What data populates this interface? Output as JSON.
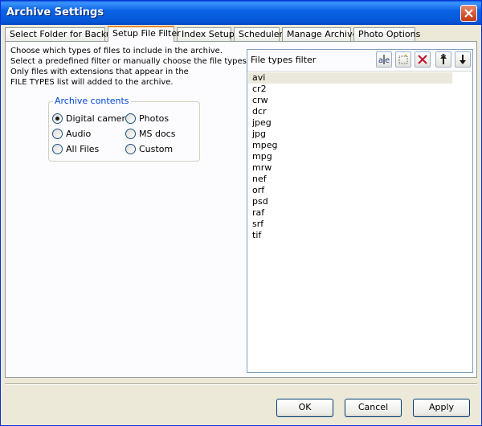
{
  "window": {
    "title": "Archive Settings"
  },
  "tabs": [
    {
      "label": "Select Folder for Backup"
    },
    {
      "label": "Setup File Filter"
    },
    {
      "label": "Index Setup"
    },
    {
      "label": "Scheduler"
    },
    {
      "label": "Manage Archive"
    },
    {
      "label": "Photo Options"
    }
  ],
  "active_tab": "Setup File Filter",
  "description": [
    "Choose which types of files to include in the archive.",
    "Select a predefined filter or manually choose the file types.",
    "Only files with extensions that appear in the",
    "FILE TYPES list will added to the archive."
  ],
  "archive_contents": {
    "legend": "Archive contents",
    "options": [
      {
        "label": "Digital camera",
        "checked": true
      },
      {
        "label": "Photos",
        "checked": false
      },
      {
        "label": "Audio",
        "checked": false
      },
      {
        "label": "MS docs",
        "checked": false
      },
      {
        "label": "All Files",
        "checked": false
      },
      {
        "label": "Custom",
        "checked": false
      }
    ]
  },
  "file_types": {
    "header": "File types filter",
    "toolbar": [
      "rename-icon",
      "new-item-icon",
      "delete-icon",
      "move-up-icon",
      "move-down-icon"
    ],
    "items": [
      "avi",
      "cr2",
      "crw",
      "dcr",
      "jpeg",
      "jpg",
      "mpeg",
      "mpg",
      "mrw",
      "nef",
      "orf",
      "psd",
      "raf",
      "srf",
      "tif"
    ],
    "selected": "avi"
  },
  "buttons": {
    "ok": "OK",
    "cancel": "Cancel",
    "apply": "Apply"
  },
  "colors": {
    "titlebar": "#0555d6",
    "close": "#d4532e",
    "active_tab_accent": "#e68b2c",
    "legend": "#0046d5"
  }
}
